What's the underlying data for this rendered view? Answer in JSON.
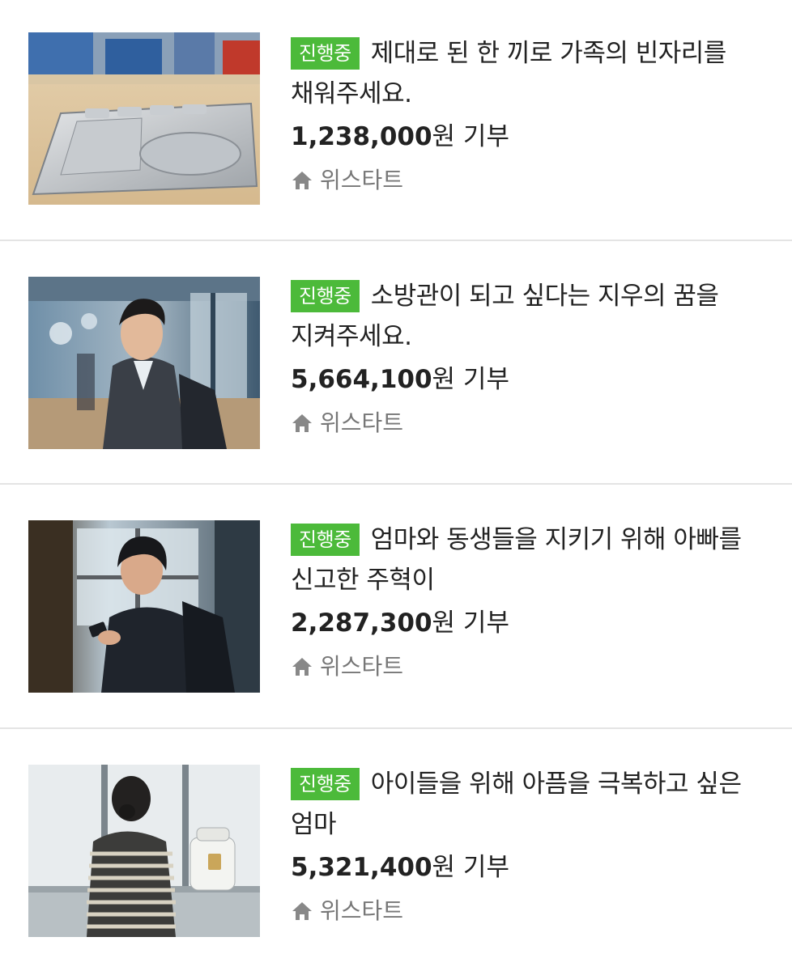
{
  "items": [
    {
      "status": "진행중",
      "title": "제대로 된 한 끼로 가족의 빈자리를 채워주세요.",
      "amount": "1,238,000",
      "amount_unit": "원 기부",
      "org": "위스타트",
      "image": "meal-tray-photo"
    },
    {
      "status": "진행중",
      "title": "소방관이 되고 싶다는 지우의 꿈을 지켜주세요.",
      "amount": "5,664,100",
      "amount_unit": "원 기부",
      "org": "위스타트",
      "image": "student-in-hallway-photo"
    },
    {
      "status": "진행중",
      "title": "엄마와 동생들을 지키기 위해 아빠를 신고한 주혁이",
      "amount": "2,287,300",
      "amount_unit": "원 기부",
      "org": "위스타트",
      "image": "student-with-phone-photo"
    },
    {
      "status": "진행중",
      "title": "아이들을 위해 아픔을 극복하고 싶은 엄마",
      "amount": "5,321,400",
      "amount_unit": "원 기부",
      "org": "위스타트",
      "image": "mother-in-kitchen-photo"
    }
  ],
  "colors": {
    "badge": "#4cba3a",
    "divider": "#e4e4e4",
    "meta": "#777777"
  }
}
